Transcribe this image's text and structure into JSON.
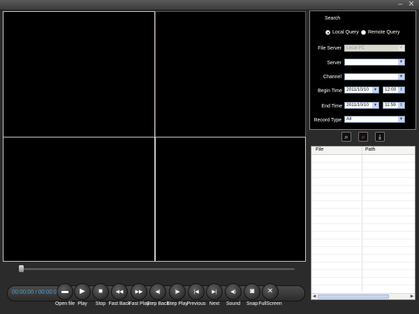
{
  "window": {
    "minimize_glyph": "–",
    "close_glyph": "✕"
  },
  "player": {
    "timecode": "00:00:00 / 00:00:00",
    "active_pane": 2,
    "progress": 0,
    "controls": [
      {
        "id": "open-file",
        "label": "Open file",
        "icon": "folder-icon",
        "glyph": "▬"
      },
      {
        "id": "play",
        "label": "Play",
        "icon": "play-icon",
        "glyph": "▶"
      },
      {
        "id": "stop",
        "label": "Stop",
        "icon": "stop-icon",
        "glyph": "■"
      },
      {
        "id": "fast-back",
        "label": "Fast Back",
        "icon": "rewind-icon",
        "glyph": "◀◀"
      },
      {
        "id": "fast-play",
        "label": "Fast Play",
        "icon": "fast-forward-icon",
        "glyph": "▶▶"
      },
      {
        "id": "step-back",
        "label": "Step Back",
        "icon": "step-back-icon",
        "glyph": "◀|"
      },
      {
        "id": "step-play",
        "label": "Step Play",
        "icon": "step-play-icon",
        "glyph": "|▶"
      },
      {
        "id": "previous",
        "label": "Previous",
        "icon": "previous-icon",
        "glyph": "|◀"
      },
      {
        "id": "next",
        "label": "Next",
        "icon": "next-icon",
        "glyph": "▶|"
      },
      {
        "id": "sound",
        "label": "Sound",
        "icon": "speaker-icon",
        "glyph": "◀)"
      },
      {
        "id": "snap",
        "label": "Snap",
        "icon": "camera-icon",
        "glyph": "◙"
      },
      {
        "id": "fullscreen",
        "label": "FullScreen",
        "icon": "fullscreen-icon",
        "glyph": "✕"
      }
    ]
  },
  "search": {
    "legend": "Search",
    "local_query": "Local Query",
    "remote_query": "Remote Query",
    "selected_mode": "local",
    "file_server_label": "File Server",
    "file_server_value": "Local PC",
    "server_label": "Server",
    "server_value": "",
    "channel_label": "Channel",
    "channel_value": "",
    "begin_time_label": "Begin Time",
    "begin_date": "2011/10/10",
    "begin_time": "12:00",
    "end_time_label": "End Time",
    "end_date": "2011/10/10",
    "end_time": "11:59",
    "record_type_label": "Record Type",
    "record_type_value": "All"
  },
  "actions": [
    {
      "id": "search",
      "icon": "search-icon",
      "glyph": "⌕"
    },
    {
      "id": "remote-search",
      "icon": "remote-search-icon",
      "glyph": "⌕"
    },
    {
      "id": "download",
      "icon": "download-icon",
      "glyph": "⤓"
    }
  ],
  "filelist": {
    "columns": [
      "File",
      "Path"
    ],
    "rows": []
  }
}
